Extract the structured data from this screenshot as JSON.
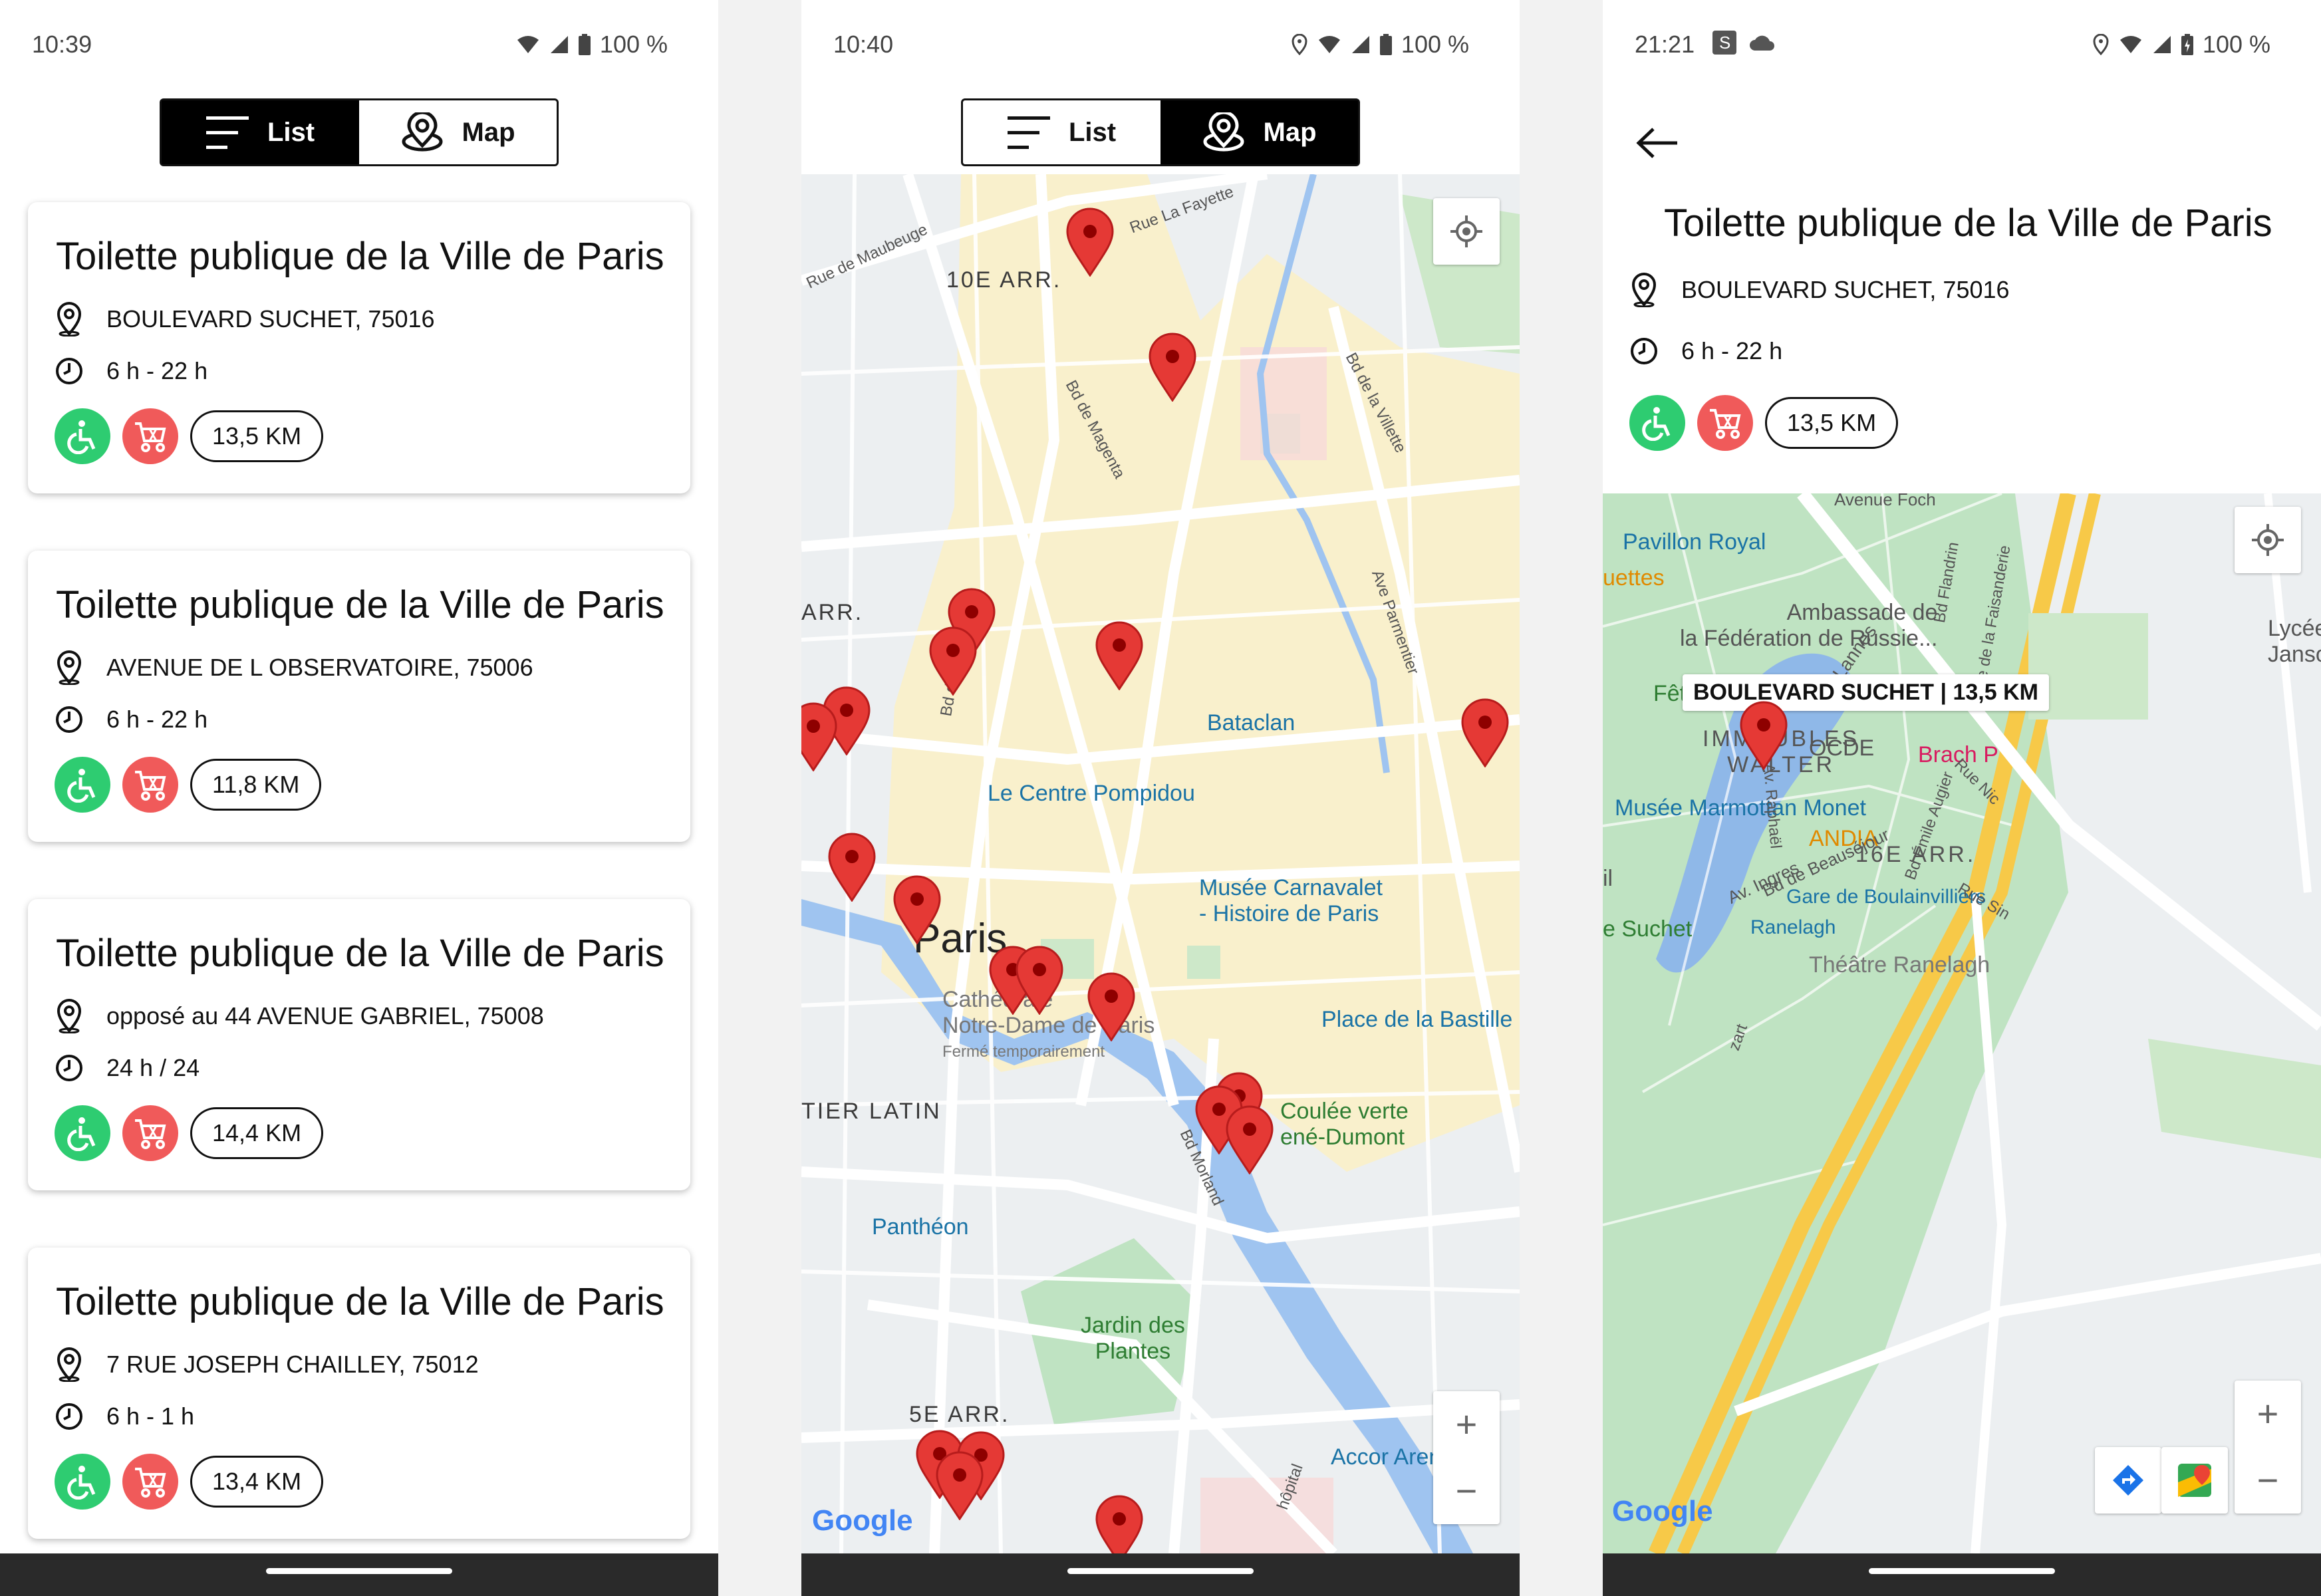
{
  "status_bars": [
    {
      "time": "10:39",
      "battery": "100 %"
    },
    {
      "time": "10:40",
      "battery": "100 %"
    },
    {
      "time": "21:21",
      "battery": "100 %"
    }
  ],
  "segmented": {
    "list_label": "List",
    "map_label": "Map"
  },
  "cards": [
    {
      "title": "Toilette publique de la Ville de Paris",
      "address": "BOULEVARD SUCHET, 75016",
      "hours": "6 h - 22 h",
      "distance": "13,5 KM"
    },
    {
      "title": "Toilette publique de la Ville de Paris",
      "address": "AVENUE DE L OBSERVATOIRE, 75006",
      "hours": "6 h - 22 h",
      "distance": "11,8 KM"
    },
    {
      "title": "Toilette publique de la Ville de Paris",
      "address": "opposé au 44 AVENUE GABRIEL, 75008",
      "hours": "24 h / 24",
      "distance": "14,4 KM"
    },
    {
      "title": "Toilette publique de la Ville de Paris",
      "address": "7  RUE JOSEPH CHAILLEY, 75012",
      "hours": "6 h - 1 h",
      "distance": "13,4 KM"
    }
  ],
  "map_view": {
    "labels": {
      "arr10": "10E ARR.",
      "arr_left": "ARR.",
      "paris": "Paris",
      "latin": "TIER LATIN",
      "arr5": "5E ARR.",
      "jardin": "Jardin des\nPlantes"
    },
    "pois": {
      "bataclan": "Bataclan",
      "pompidou": "Le Centre Pompidou",
      "carnavalet": "Musée Carnavalet\n- Histoire de Paris",
      "bastille": "Place de la Bastille",
      "notredame": "Cathédrale\nNotre-Dame de Paris",
      "notredame_sub": "Fermé temporairement",
      "coulee": "Coulée verte\nené-Dumont",
      "pantheon": "Panthéon",
      "accor": "Accor Arena"
    },
    "streets": {
      "lafayette": "Rue La Fayette",
      "maubeuge": "Rue de Maubeuge",
      "magenta": "Bd de Magenta",
      "villette": "Bd de la Villette",
      "parmentier": "Ave Parmentier",
      "morland": "Bd Morland",
      "hopital": "hôpital",
      "bd_de": "Bd de"
    },
    "attribution": "Google"
  },
  "detail": {
    "title": "Toilette publique de la Ville de Paris",
    "address": "BOULEVARD SUCHET, 75016",
    "hours": "6 h - 22 h",
    "distance": "13,5 KM",
    "callout": "BOULEVARD SUCHET | 13,5 KM",
    "map_labels": {
      "pavillon": "Pavillon Royal",
      "quettes": "uettes",
      "ambassade": "Ambassade de\nla Fédération de Russie...",
      "lycee": "Lycée\nJanson d",
      "fete": "Fête à Neu-",
      "immeubles": "IMMEUBLES\nWALTER",
      "ocde": "OCDE",
      "brach": "Brach P",
      "marmottan": "Musée Marmottan Monet",
      "andia": "ANDIA",
      "arr16": "16E ARR.",
      "gare": "Gare de Boulainvilliers",
      "suchet": "e Suchet",
      "ranelagh": "Ranelagh",
      "theatre": "Théâtre Ranelagh",
      "avenue_foch": "Avenue Foch",
      "bd_lannes": "Bd Lannes",
      "av_ingres": "Av. Ingres",
      "beausejour": "Bd de Beauséjour",
      "raphael": "Av. Raphaël",
      "emile_augier": "Bd Émile Augier",
      "flandrin": "Bd Flandrin",
      "faisanderie": "Rue de la Faisanderie",
      "zart": "zart",
      "il": "il",
      "rue_nic": "Rue Nic",
      "rue_sin": "Rue Sin"
    },
    "attribution": "Google"
  },
  "colors": {
    "green": "#2ecc71",
    "red": "#f05a5a",
    "pin": "#e53935"
  }
}
